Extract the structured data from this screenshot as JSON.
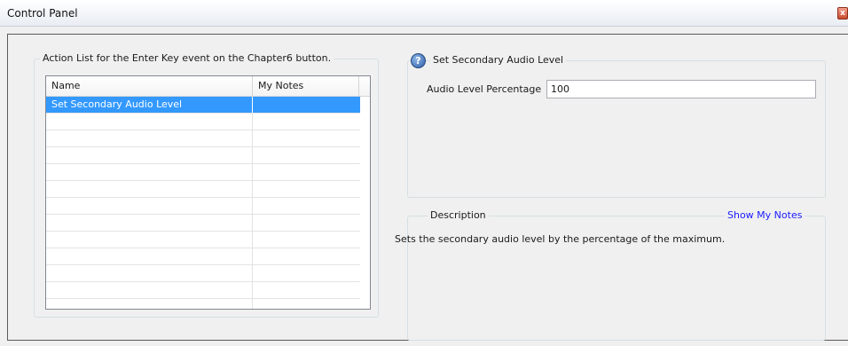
{
  "window": {
    "title": "Control Panel",
    "close_glyph": "x"
  },
  "action_list": {
    "legend": "Action List for the Enter Key event on the Chapter6 button.",
    "columns": [
      "Name",
      "My Notes"
    ],
    "rows": [
      {
        "name": "Set Secondary Audio Level",
        "notes": "",
        "selected": true
      }
    ]
  },
  "properties": {
    "icon": "help-icon",
    "icon_glyph": "?",
    "legend": "Set Secondary Audio Level",
    "field_label": "Audio Level Percentage",
    "field_value": "100"
  },
  "description": {
    "legend": "Description",
    "link": "Show My Notes",
    "text": "Sets the secondary audio level by the percentage of the maximum."
  }
}
